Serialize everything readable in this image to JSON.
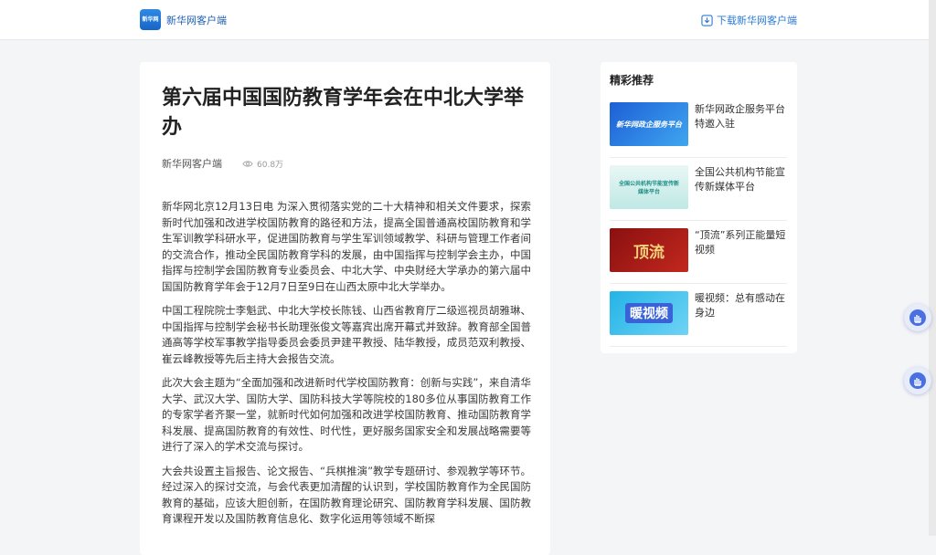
{
  "header": {
    "logo_text": "新华网",
    "app_name": "新华网客户端",
    "download_label": "下载新华网客户端"
  },
  "article": {
    "title": "第六届中国国防教育学年会在中北大学举办",
    "source": "新华网客户端",
    "views": "60.8万",
    "paragraphs": [
      "新华网北京12月13日电 为深入贯彻落实党的二十大精神和相关文件要求，探索新时代加强和改进学校国防教育的路径和方法，提高全国普通高校国防教育和学生军训教学科研水平，促进国防教育与学生军训领域教学、科研与管理工作者间的交流合作，推动全民国防教育学科的发展，由中国指挥与控制学会主办，中国指挥与控制学会国防教育专业委员会、中北大学、中央财经大学承办的第六届中国国防教育学年会于12月7日至9日在山西太原中北大学举办。",
      "中国工程院院士李魁武、中北大学校长陈钱、山西省教育厅二级巡视员胡雅琳、中国指挥与控制学会秘书长助理张俊文等嘉宾出席开幕式并致辞。教育部全国普通高等学校军事教学指导委员会委员尹建平教授、陆华教授，成员范双利教授、崔云峰教授等先后主持大会报告交流。",
      "此次大会主题为“全面加强和改进新时代学校国防教育：创新与实践”，来自清华大学、武汉大学、国防大学、国防科技大学等院校的180多位从事国防教育工作的专家学者齐聚一堂，就新时代如何加强和改进学校国防教育、推动国防教育学科发展、提高国防教育的有效性、时代性，更好服务国家安全和发展战略需要等进行了深入的学术交流与探讨。",
      "大会共设置主旨报告、论文报告、“兵棋推演”教学专题研讨、参观教学等环节。经过深入的探讨交流，与会代表更加清醒的认识到，学校国防教育作为全民国防教育的基础，应该大胆创新，在国防教育理论研究、国防教育学科发展、国防教育课程开发以及国防教育信息化、数字化运用等领域不断探"
    ]
  },
  "sidebar": {
    "title": "精彩推荐",
    "items": [
      {
        "label": "新华网政企服务平台特邀入驻",
        "thumb_text": "新华网政企服务平台"
      },
      {
        "label": "全国公共机构节能宣传新媒体平台",
        "thumb_text": "全国公共机构节能宣传新媒体平台"
      },
      {
        "label": "“顶流”系列正能量短视频",
        "thumb_text": "顶流"
      },
      {
        "label": "暖视频：总有感动在身边",
        "thumb_text": "暖视频"
      }
    ]
  },
  "colors": {
    "brand": "#1e5fb3",
    "link": "#2b7bd6",
    "float_button": "#4a6fe0"
  }
}
